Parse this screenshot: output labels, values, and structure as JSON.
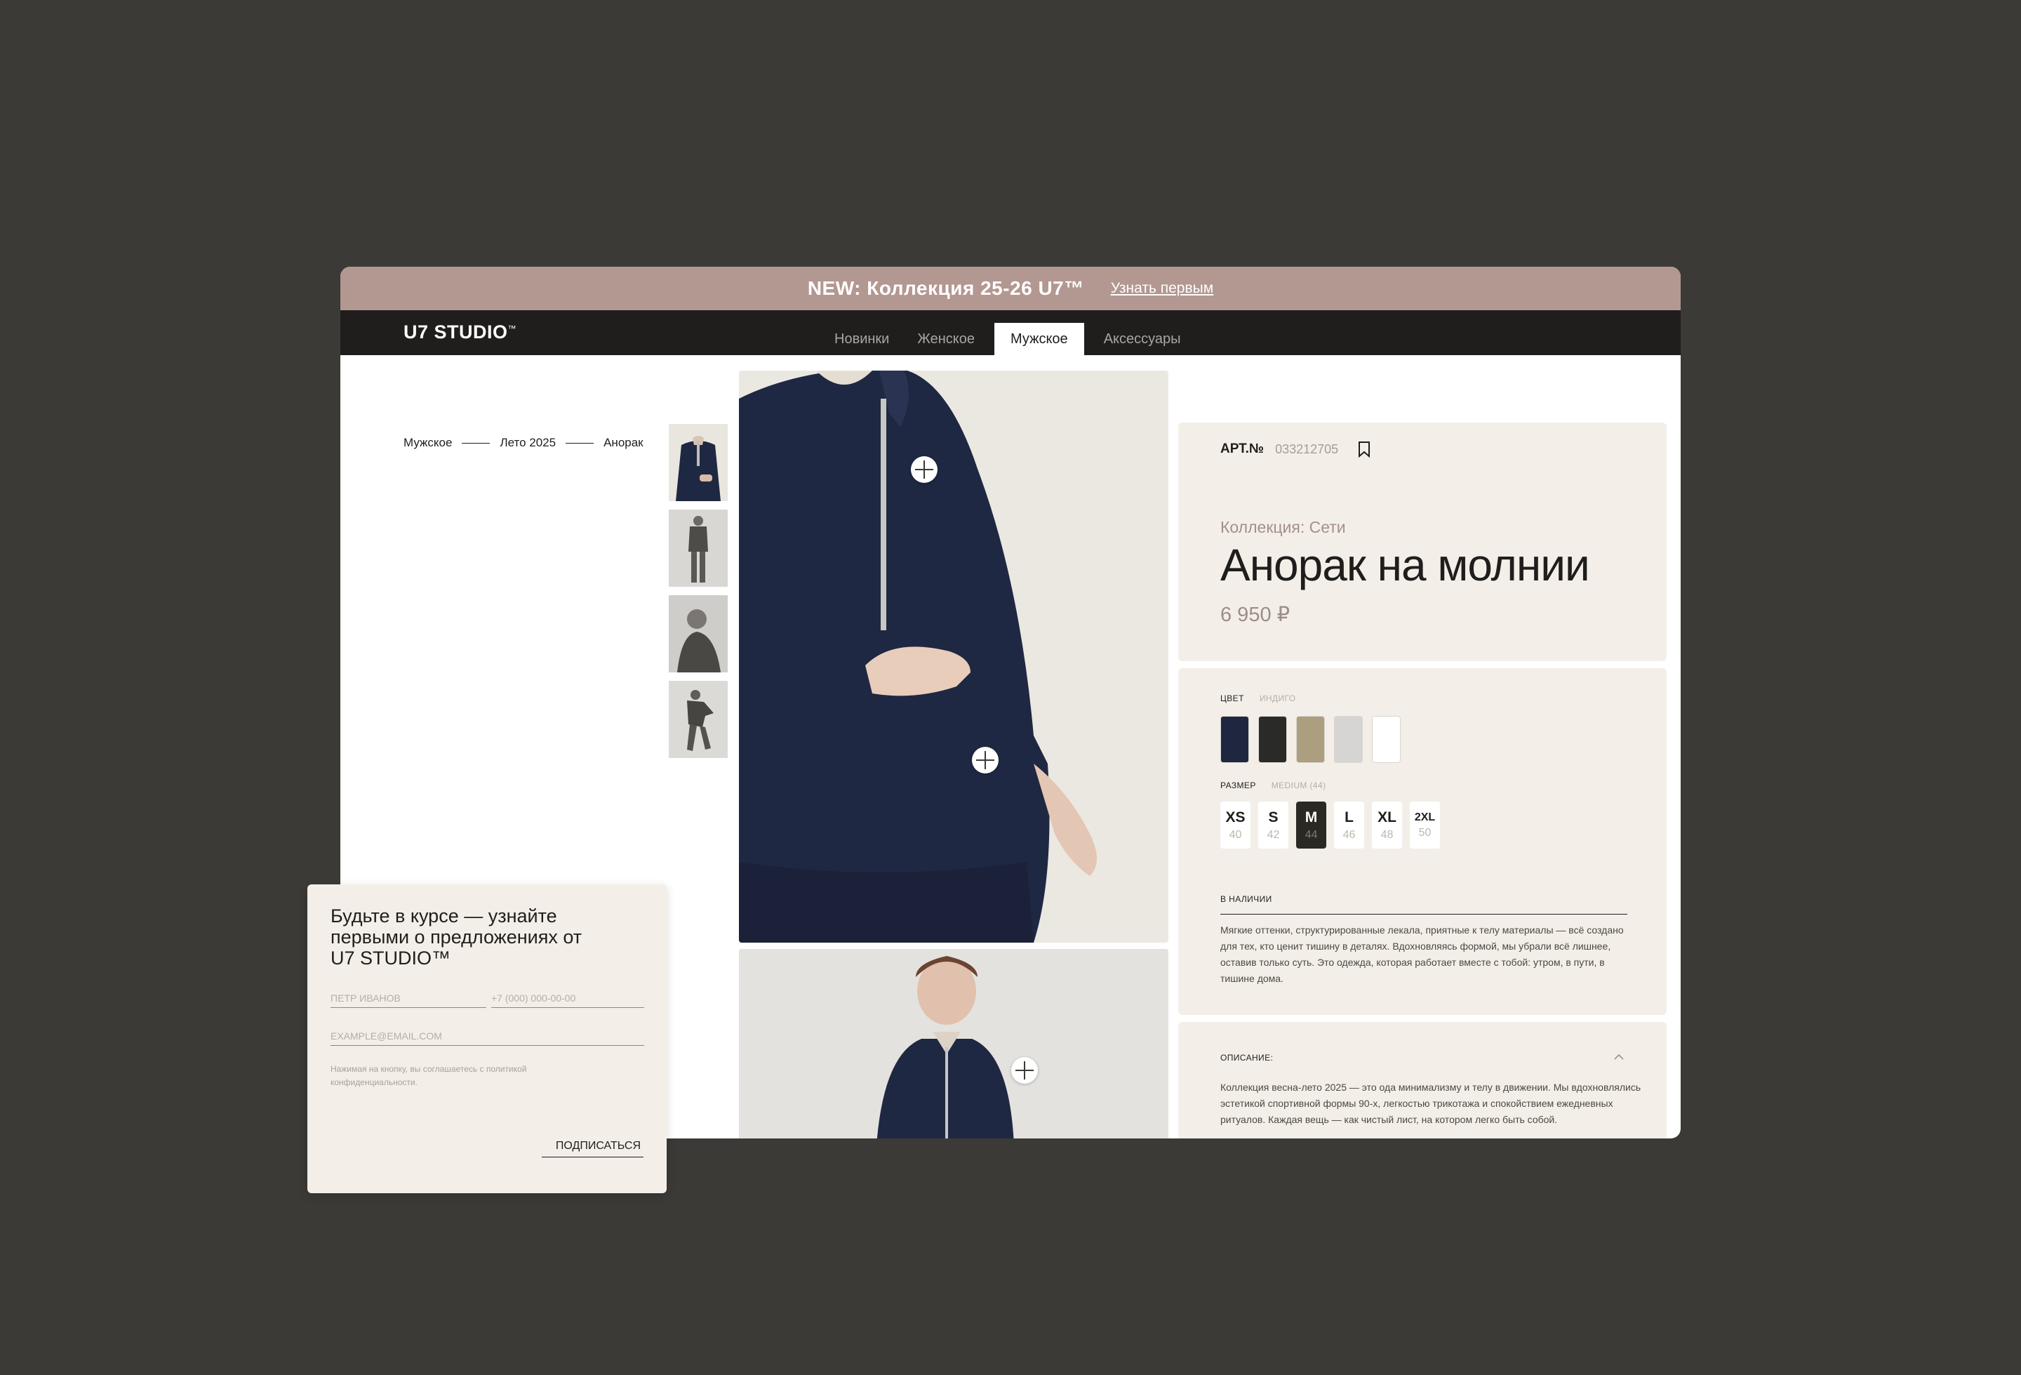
{
  "promo": {
    "title": "NEW: Коллекция 25-26 U7™",
    "link": "Узнать первым"
  },
  "header": {
    "logo": "U7  STUDIO",
    "logo_mark": "™",
    "tabs": [
      {
        "label": "Новинки"
      },
      {
        "label": "Женское"
      },
      {
        "label": "Мужское",
        "active": true
      },
      {
        "label": "Аксессуары"
      }
    ]
  },
  "breadcrumb": [
    "Мужское",
    "Лето 2025",
    "Анорак"
  ],
  "product": {
    "art_label": "АРТ.№",
    "art_value": "033212705",
    "collection": "Коллекция: Сети",
    "title": "Анорак на молнии",
    "price": "6 950 ₽"
  },
  "options": {
    "color_label": "ЦВЕТ",
    "color_value": "ИНДИГО",
    "colors": [
      "#1e2640",
      "#2a2a28",
      "#ab9f7f",
      "#d6d5d3",
      "#ffffff"
    ],
    "size_label": "РАЗМЕР",
    "size_value": "MEDIUM (44)",
    "sizes": [
      {
        "letter": "XS",
        "num": "40"
      },
      {
        "letter": "S",
        "num": "42"
      },
      {
        "letter": "M",
        "num": "44",
        "selected": true
      },
      {
        "letter": "L",
        "num": "46"
      },
      {
        "letter": "XL",
        "num": "48"
      },
      {
        "letter": "2XL",
        "num": "50"
      }
    ],
    "stock": "В НАЛИЧИИ",
    "text": "Мягкие оттенки, структурированные лекала, приятные к телу материалы — всё создано для тех, кто ценит тишину в деталях. Вдохновляясь формой, мы убрали всё лишнее, оставив только суть. Это одежда, которая работает вместе с тобой: утром, в пути, в тишине дома."
  },
  "description": {
    "heading": "ОПИСАНИЕ:",
    "text": "Коллекция весна-лето 2025 — это ода минимализму и телу в движении. Мы вдохновлялись эстетикой спортивной формы 90-х, легкостью трикотажа и спокойствием ежедневных ритуалов. Каждая вещь — как чистый лист, на котором легко быть собой."
  },
  "newsletter": {
    "title": "Будьте в курсе — узнайте первыми о предложениях от U7 STUDIO™",
    "name_placeholder": "ПЕТР ИВАНОВ",
    "phone_placeholder": "+7 (000) 000-00-00",
    "email_placeholder": "EXAMPLE@EMAIL.COM",
    "note": "Нажимая на кнопку, вы соглашаетесь с политикой конфиденциальности.",
    "button": "ПОДПИСАТЬСЯ"
  },
  "icons": [
    "plus-icon",
    "bookmark-icon",
    "chevron-up-icon"
  ]
}
